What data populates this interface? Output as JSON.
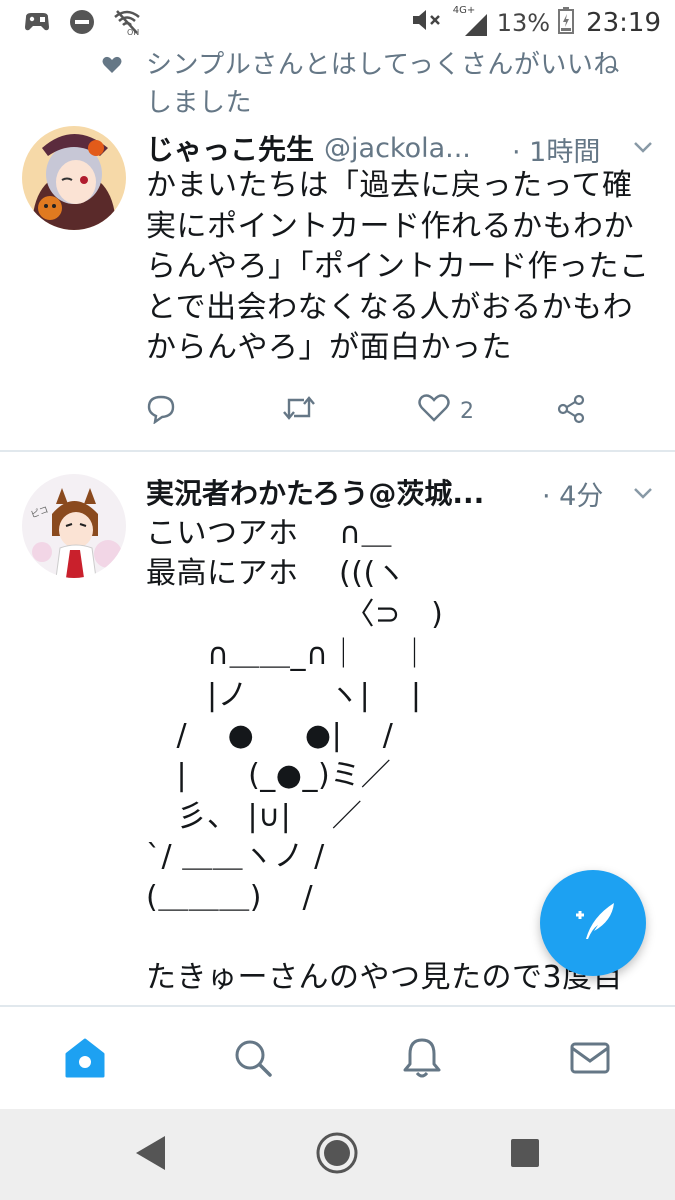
{
  "status_bar": {
    "network": "4G+",
    "battery": "13%",
    "time": "23:19"
  },
  "liked_notice": "シンプルさんとはしてっくさんがいいねしました",
  "tweets": [
    {
      "name": "じゃっこ先生",
      "handle": "@jackola...",
      "time": "· 1時間",
      "text": "かまいたちは「過去に戻ったって確実にポイントカード作れるかもわからんやろ」「ポイントカード作ったことで出会わなくなる人がおるかもわからんやろ」が面白かった",
      "like_count": "2"
    },
    {
      "name": "実況者わかたろう@茨城...",
      "time": "· 4分",
      "text": "こいつアホ　 ∩＿\n最高にアホ　 (((ヽ\n　　　　　　　〈⊃　)\n　　∩＿＿_∩｜　 ｜\n　　|ノ　　  ヽ|　 |\n　/　 ●　  ●|　 /\n　|　　(_●_)ミ／\n　彡、 |∪|　 ／\n`/ ＿＿ヽノ /\n(＿＿＿)　 /\n\nたきゅーさんのやつ見たので3度目"
    }
  ],
  "tabs": [
    "home",
    "search",
    "notifications",
    "messages"
  ],
  "colors": {
    "accent": "#1da1f2",
    "text": "#14171a",
    "secondary": "#657786",
    "divider": "#e1e8ed"
  }
}
